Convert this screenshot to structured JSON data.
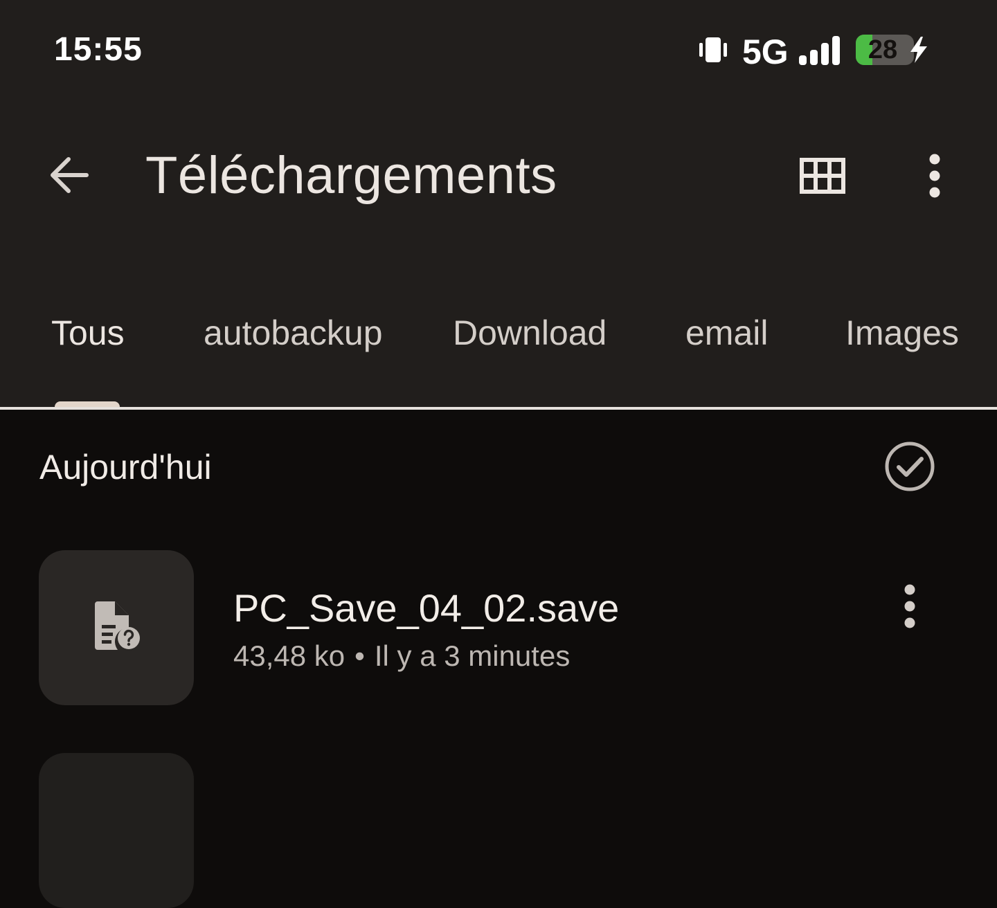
{
  "status_bar": {
    "time": "15:55",
    "network": "5G",
    "battery_level": "28",
    "battery_fraction": 0.28,
    "icons": [
      "vibrate-icon",
      "signal-icon",
      "battery-icon",
      "charging-icon"
    ]
  },
  "app_bar": {
    "title": "Téléchargements",
    "icons": [
      "back-arrow-icon",
      "grid-view-icon",
      "more-vert-icon"
    ]
  },
  "tabs": [
    {
      "label": "Tous",
      "active": true
    },
    {
      "label": "autobackup",
      "active": false
    },
    {
      "label": "Download",
      "active": false
    },
    {
      "label": "email",
      "active": false
    },
    {
      "label": "Images",
      "active": false
    }
  ],
  "section": {
    "title": "Aujourd'hui",
    "icon": "select-all-check-icon"
  },
  "files": [
    {
      "name": "PC_Save_04_02.save",
      "size": "43,48 ko",
      "separator": "•",
      "time": "Il y a 3 minutes",
      "icon": "unknown-file-icon"
    }
  ],
  "colors": {
    "top_background": "#211e1c",
    "page_background": "#0e0c0b",
    "tab_indicator": "#e3d6ca",
    "battery_green": "#4cbb45"
  }
}
